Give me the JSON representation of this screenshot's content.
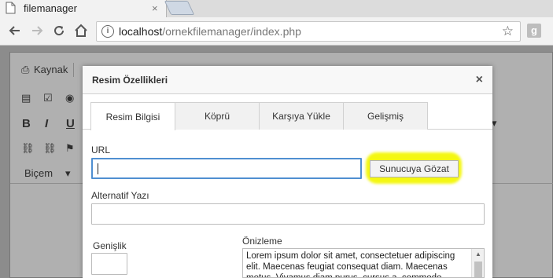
{
  "browser": {
    "tab_title": "filemanager",
    "tab_close": "×",
    "url_host": "localhost",
    "url_path": "/ornekfilemanager/index.php",
    "ext_icon": "g"
  },
  "editor": {
    "source_label": "Kaynak",
    "style_label": "Biçem"
  },
  "dialog": {
    "title": "Resim Özellikleri",
    "close": "×",
    "tabs": [
      {
        "label": "Resim Bilgisi",
        "active": true
      },
      {
        "label": "Köprü",
        "active": false
      },
      {
        "label": "Karşıya Yükle",
        "active": false
      },
      {
        "label": "Gelişmiş",
        "active": false
      }
    ],
    "url_label": "URL",
    "url_value": "",
    "browse_button": "Sunucuya Gözat",
    "highlight_color": "#f4f711",
    "alt_label": "Alternatif Yazı",
    "alt_value": "",
    "width_label": "Genişlik",
    "width_value": "",
    "preview_label": "Önizleme",
    "preview_text": "Lorem ipsum dolor sit amet, consectetuer adipiscing elit. Maecenas feugiat consequat diam. Maecenas metus. Vivamus diam purus, cursus a, commodo"
  },
  "icons": [
    "page-icon",
    "back-arrow-icon",
    "forward-arrow-icon",
    "reload-icon",
    "home-icon",
    "info-icon",
    "star-icon",
    "close-icon",
    "bold-icon",
    "italic-icon",
    "underline-icon",
    "link-icon",
    "flag-icon"
  ]
}
